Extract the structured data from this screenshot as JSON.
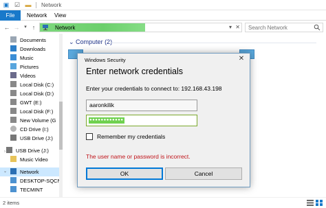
{
  "window": {
    "title": "Network"
  },
  "ribbon": {
    "tabs": [
      {
        "label": "File"
      },
      {
        "label": "Network"
      },
      {
        "label": "View"
      }
    ]
  },
  "address": {
    "location": "Network",
    "search_placeholder": "Search Network"
  },
  "sidebar": {
    "items": [
      {
        "label": "Documents",
        "icon": "documents-icon"
      },
      {
        "label": "Downloads",
        "icon": "downloads-icon"
      },
      {
        "label": "Music",
        "icon": "music-icon"
      },
      {
        "label": "Pictures",
        "icon": "pictures-icon"
      },
      {
        "label": "Videos",
        "icon": "videos-icon"
      },
      {
        "label": "Local Disk (C:)",
        "icon": "drive-icon"
      },
      {
        "label": "Local Disk (D:)",
        "icon": "drive-icon"
      },
      {
        "label": "GWT (E:)",
        "icon": "drive-icon"
      },
      {
        "label": "Local Disk (F:)",
        "icon": "drive-icon"
      },
      {
        "label": "New Volume (G",
        "icon": "drive-icon"
      },
      {
        "label": "CD Drive (I:)",
        "icon": "cd-drive-icon"
      },
      {
        "label": "USB Drive (J:)",
        "icon": "usb-drive-icon"
      },
      {
        "label": "USB Drive (J:)",
        "icon": "usb-drive-icon"
      },
      {
        "label": "Music Video",
        "icon": "folder-icon"
      },
      {
        "label": "Network",
        "icon": "network-icon"
      },
      {
        "label": "DESKTOP-SQCN",
        "icon": "computer-icon"
      },
      {
        "label": "TECMINT",
        "icon": "computer-icon"
      }
    ]
  },
  "content": {
    "group_header": "Computer (2)"
  },
  "status": {
    "items_count": "2 items"
  },
  "dialog": {
    "title": "Windows Security",
    "heading": "Enter network credentials",
    "prompt": "Enter your credentials to connect to: 192.168.43.198",
    "username": "aaronkilik",
    "password_mask": "●●●●●●●●●●●●",
    "remember_label": "Remember my credentials",
    "error": "The user name or password is incorrect.",
    "ok_label": "OK",
    "cancel_label": "Cancel"
  },
  "colors": {
    "accent": "#1979ca",
    "selection": "#cce8ff",
    "error": "#c0141a",
    "address_highlight": "#6ccf6c",
    "password_highlight": "#6fd14f"
  }
}
